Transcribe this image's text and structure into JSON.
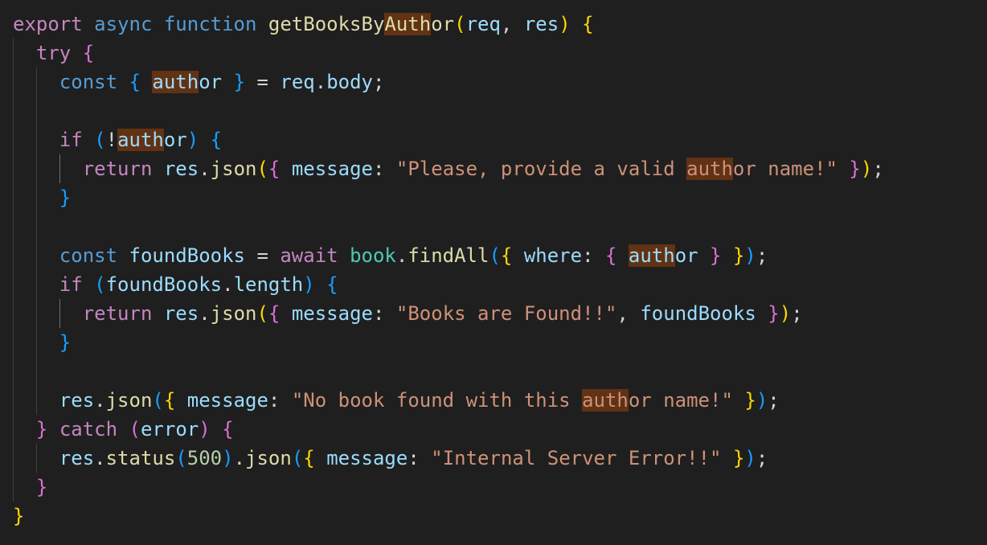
{
  "editor": {
    "language": "javascript",
    "highlight_term": "auth",
    "colors": {
      "background": "#1f1f1f",
      "control_keyword": "#c586c0",
      "declaration_keyword": "#569cd6",
      "function": "#dcdcaa",
      "variable": "#9cdcfe",
      "string": "#ce9178",
      "number": "#b5cea8",
      "class": "#4ec9b0",
      "bracket_level_1": "#ffd700",
      "bracket_level_2": "#da70d6",
      "bracket_level_3": "#179fff",
      "match_highlight": "#613214"
    },
    "lines": [
      [
        [
          "export",
          "kw-store"
        ],
        [
          " ",
          "op"
        ],
        [
          "async",
          "kw-decl"
        ],
        [
          " ",
          "op"
        ],
        [
          "function",
          "kw-decl"
        ],
        [
          " ",
          "op"
        ],
        [
          "getBooksBy",
          "fn"
        ],
        [
          "Auth",
          "fn hl"
        ],
        [
          "or",
          "fn"
        ],
        [
          "(",
          "b1"
        ],
        [
          "req",
          "var"
        ],
        [
          ", ",
          "op"
        ],
        [
          "res",
          "var"
        ],
        [
          ")",
          "b1"
        ],
        [
          " ",
          "op"
        ],
        [
          "{",
          "b1"
        ]
      ],
      [
        [
          "  ",
          "op"
        ],
        [
          "try",
          "kw-store"
        ],
        [
          " ",
          "op"
        ],
        [
          "{",
          "b2"
        ]
      ],
      [
        [
          "    ",
          "op"
        ],
        [
          "const",
          "kw-decl"
        ],
        [
          " ",
          "op"
        ],
        [
          "{",
          "b3"
        ],
        [
          " ",
          "op"
        ],
        [
          "auth",
          "var hl"
        ],
        [
          "or",
          "var"
        ],
        [
          " ",
          "op"
        ],
        [
          "}",
          "b3"
        ],
        [
          " = ",
          "op"
        ],
        [
          "req",
          "var"
        ],
        [
          ".",
          "op"
        ],
        [
          "body",
          "var"
        ],
        [
          ";",
          "op"
        ]
      ],
      [],
      [
        [
          "    ",
          "op"
        ],
        [
          "if",
          "kw-store"
        ],
        [
          " ",
          "op"
        ],
        [
          "(",
          "b3"
        ],
        [
          "!",
          "op"
        ],
        [
          "auth",
          "var hl"
        ],
        [
          "or",
          "var"
        ],
        [
          ")",
          "b3"
        ],
        [
          " ",
          "op"
        ],
        [
          "{",
          "b3"
        ]
      ],
      [
        [
          "      ",
          "op"
        ],
        [
          "return",
          "kw-store"
        ],
        [
          " ",
          "op"
        ],
        [
          "res",
          "var"
        ],
        [
          ".",
          "op"
        ],
        [
          "json",
          "fn"
        ],
        [
          "(",
          "b1"
        ],
        [
          "{",
          "b2"
        ],
        [
          " ",
          "op"
        ],
        [
          "message",
          "var"
        ],
        [
          ": ",
          "op"
        ],
        [
          "\"Please, provide a valid ",
          "str"
        ],
        [
          "auth",
          "str hl"
        ],
        [
          "or name!\"",
          "str"
        ],
        [
          " ",
          "op"
        ],
        [
          "}",
          "b2"
        ],
        [
          ")",
          "b1"
        ],
        [
          ";",
          "op"
        ]
      ],
      [
        [
          "    ",
          "op"
        ],
        [
          "}",
          "b3"
        ]
      ],
      [],
      [
        [
          "    ",
          "op"
        ],
        [
          "const",
          "kw-decl"
        ],
        [
          " ",
          "op"
        ],
        [
          "foundBooks",
          "var"
        ],
        [
          " = ",
          "op"
        ],
        [
          "await",
          "kw-store"
        ],
        [
          " ",
          "op"
        ],
        [
          "book",
          "cls"
        ],
        [
          ".",
          "op"
        ],
        [
          "findAll",
          "fn"
        ],
        [
          "(",
          "b3"
        ],
        [
          "{",
          "b1"
        ],
        [
          " ",
          "op"
        ],
        [
          "where",
          "var"
        ],
        [
          ": ",
          "op"
        ],
        [
          "{",
          "b2"
        ],
        [
          " ",
          "op"
        ],
        [
          "auth",
          "var hl"
        ],
        [
          "or",
          "var"
        ],
        [
          " ",
          "op"
        ],
        [
          "}",
          "b2"
        ],
        [
          " ",
          "op"
        ],
        [
          "}",
          "b1"
        ],
        [
          ")",
          "b3"
        ],
        [
          ";",
          "op"
        ]
      ],
      [
        [
          "    ",
          "op"
        ],
        [
          "if",
          "kw-store"
        ],
        [
          " ",
          "op"
        ],
        [
          "(",
          "b3"
        ],
        [
          "foundBooks",
          "var"
        ],
        [
          ".",
          "op"
        ],
        [
          "length",
          "var"
        ],
        [
          ")",
          "b3"
        ],
        [
          " ",
          "op"
        ],
        [
          "{",
          "b3"
        ]
      ],
      [
        [
          "      ",
          "op"
        ],
        [
          "return",
          "kw-store"
        ],
        [
          " ",
          "op"
        ],
        [
          "res",
          "var"
        ],
        [
          ".",
          "op"
        ],
        [
          "json",
          "fn"
        ],
        [
          "(",
          "b1"
        ],
        [
          "{",
          "b2"
        ],
        [
          " ",
          "op"
        ],
        [
          "message",
          "var"
        ],
        [
          ": ",
          "op"
        ],
        [
          "\"Books are Found!!\"",
          "str"
        ],
        [
          ", ",
          "op"
        ],
        [
          "foundBooks",
          "var"
        ],
        [
          " ",
          "op"
        ],
        [
          "}",
          "b2"
        ],
        [
          ")",
          "b1"
        ],
        [
          ";",
          "op"
        ]
      ],
      [
        [
          "    ",
          "op"
        ],
        [
          "}",
          "b3"
        ]
      ],
      [],
      [
        [
          "    ",
          "op"
        ],
        [
          "res",
          "var"
        ],
        [
          ".",
          "op"
        ],
        [
          "json",
          "fn"
        ],
        [
          "(",
          "b3"
        ],
        [
          "{",
          "b1"
        ],
        [
          " ",
          "op"
        ],
        [
          "message",
          "var"
        ],
        [
          ": ",
          "op"
        ],
        [
          "\"No book found with this ",
          "str"
        ],
        [
          "auth",
          "str hl"
        ],
        [
          "or name!\"",
          "str"
        ],
        [
          " ",
          "op"
        ],
        [
          "}",
          "b1"
        ],
        [
          ")",
          "b3"
        ],
        [
          ";",
          "op"
        ]
      ],
      [
        [
          "  ",
          "op"
        ],
        [
          "}",
          "b2"
        ],
        [
          " ",
          "op"
        ],
        [
          "catch",
          "kw-store"
        ],
        [
          " ",
          "op"
        ],
        [
          "(",
          "b2"
        ],
        [
          "error",
          "var"
        ],
        [
          ")",
          "b2"
        ],
        [
          " ",
          "op"
        ],
        [
          "{",
          "b2"
        ]
      ],
      [
        [
          "    ",
          "op"
        ],
        [
          "res",
          "var"
        ],
        [
          ".",
          "op"
        ],
        [
          "status",
          "fn"
        ],
        [
          "(",
          "b3"
        ],
        [
          "500",
          "num"
        ],
        [
          ")",
          "b3"
        ],
        [
          ".",
          "op"
        ],
        [
          "json",
          "fn"
        ],
        [
          "(",
          "b3"
        ],
        [
          "{",
          "b1"
        ],
        [
          " ",
          "op"
        ],
        [
          "message",
          "var"
        ],
        [
          ": ",
          "op"
        ],
        [
          "\"Internal Server Error!!\"",
          "str"
        ],
        [
          " ",
          "op"
        ],
        [
          "}",
          "b1"
        ],
        [
          ")",
          "b3"
        ],
        [
          ";",
          "op"
        ]
      ],
      [
        [
          "  ",
          "op"
        ],
        [
          "}",
          "b2"
        ]
      ],
      [
        [
          "}",
          "b1"
        ]
      ]
    ]
  }
}
